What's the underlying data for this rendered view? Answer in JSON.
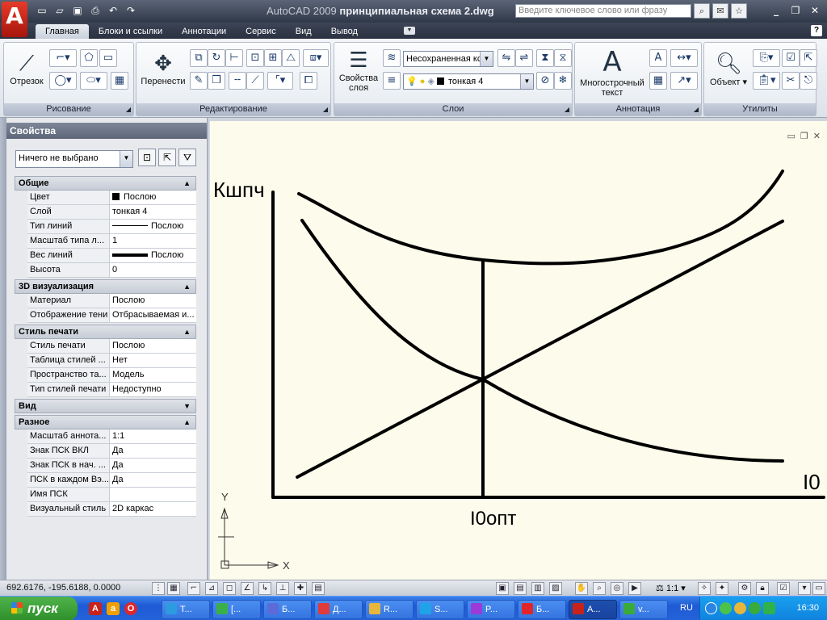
{
  "window": {
    "app_name": "AutoCAD 2009",
    "doc_name": "принципиальная схема 2.dwg",
    "search_placeholder": "Введите ключевое слово или фразу"
  },
  "qat_icons": [
    "new-icon",
    "open-icon",
    "save-icon",
    "print-icon",
    "undo-icon",
    "redo-icon"
  ],
  "tabs": [
    "Главная",
    "Блоки и ссылки",
    "Аннотации",
    "Сервис",
    "Вид",
    "Вывод"
  ],
  "help_label": "?",
  "ribbon": {
    "panels": {
      "draw": "Рисование",
      "modify": "Редактирование",
      "layers": "Слои",
      "annotation": "Аннотация",
      "utilities": "Утилиты"
    },
    "buttons": {
      "line": "Отрезок",
      "move": "Перенести",
      "layer_props_1": "Свойства",
      "layer_props_2": "слоя",
      "mtext_1": "Многострочный",
      "mtext_2": "текст",
      "object": "Объект"
    },
    "layer_state": "Несохраненная кс",
    "current_layer": "тонкая 4"
  },
  "properties": {
    "title": "Свойства",
    "selection": "Ничего не выбрано",
    "sections": [
      {
        "title": "Общие",
        "expanded": true,
        "rows": [
          {
            "k": "Цвет",
            "v": "Послою",
            "swatch": true
          },
          {
            "k": "Слой",
            "v": "тонкая 4"
          },
          {
            "k": "Тип линий",
            "v": "Послою",
            "line": "thin"
          },
          {
            "k": "Масштаб типа л...",
            "v": "1"
          },
          {
            "k": "Вес линий",
            "v": "Послою",
            "line": "thick"
          },
          {
            "k": "Высота",
            "v": "0"
          }
        ]
      },
      {
        "title": "3D визуализация",
        "expanded": true,
        "rows": [
          {
            "k": "Материал",
            "v": "Послою"
          },
          {
            "k": "Отображение тени",
            "v": "Отбрасываемая и..."
          }
        ]
      },
      {
        "title": "Стиль печати",
        "expanded": true,
        "rows": [
          {
            "k": "Стиль печати",
            "v": "Послою"
          },
          {
            "k": "Таблица стилей ...",
            "v": "Нет"
          },
          {
            "k": "Пространство та...",
            "v": "Модель"
          },
          {
            "k": "Тип стилей печати",
            "v": "Недоступно"
          }
        ]
      },
      {
        "title": "Вид",
        "expanded": false,
        "rows": []
      },
      {
        "title": "Разное",
        "expanded": true,
        "rows": [
          {
            "k": "Масштаб аннота...",
            "v": "1:1"
          },
          {
            "k": "Знак ПСК ВКЛ",
            "v": "Да"
          },
          {
            "k": "Знак ПСК в нач. ...",
            "v": "Да"
          },
          {
            "k": "ПСК в каждом Вэ...",
            "v": "Да"
          },
          {
            "k": "Имя ПСК",
            "v": ""
          },
          {
            "k": "Визуальный стиль",
            "v": "2D каркас"
          }
        ]
      }
    ]
  },
  "drawing": {
    "y_label": "Кшпч",
    "x_label": "I0",
    "opt_label": "I0опт",
    "ucs_x": "X",
    "ucs_y": "Y"
  },
  "status": {
    "coords": "692.6176, -195.6188, 0.0000",
    "scale": "1:1"
  },
  "taskbar": {
    "start": "пуск",
    "items": [
      {
        "label": "T...",
        "color": "#2c9be0"
      },
      {
        "label": "[...",
        "color": "#3bb04a"
      },
      {
        "label": "Б...",
        "color": "#5c6bd8"
      },
      {
        "label": "Д...",
        "color": "#e03a3a"
      },
      {
        "label": "R...",
        "color": "#e8b63a"
      },
      {
        "label": "S...",
        "color": "#1fa3e8"
      },
      {
        "label": "P...",
        "color": "#9b3ad8"
      },
      {
        "label": "Б...",
        "color": "#e0262a"
      },
      {
        "label": "A...",
        "color": "#c8231a",
        "active": true
      },
      {
        "label": "v...",
        "color": "#3aaa3a"
      }
    ],
    "lang": "RU",
    "time": "16:30"
  }
}
